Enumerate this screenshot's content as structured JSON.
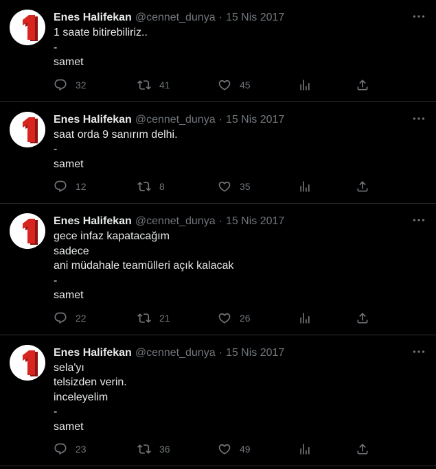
{
  "colors": {
    "background": "#000000",
    "text_primary": "#e7e9ea",
    "text_secondary": "#71767b",
    "divider": "#2f3336",
    "avatar_red": "#d7251f"
  },
  "tweets": [
    {
      "author_name": "Enes Halifekan",
      "handle": "@cennet_dunya",
      "separator": "·",
      "date": "15 Nis 2017",
      "lines": [
        "1 saate bitirebiliriz..",
        "-",
        "samet"
      ],
      "replies": "32",
      "retweets": "41",
      "likes": "45",
      "avatar_glyph": "1",
      "icons": [
        "more-icon",
        "reply-icon",
        "retweet-icon",
        "like-icon",
        "views-icon",
        "share-icon"
      ]
    },
    {
      "author_name": "Enes Halifekan",
      "handle": "@cennet_dunya",
      "separator": "·",
      "date": "15 Nis 2017",
      "lines": [
        "saat orda 9 sanırım delhi.",
        "-",
        "samet"
      ],
      "replies": "12",
      "retweets": "8",
      "likes": "35",
      "avatar_glyph": "1",
      "icons": [
        "more-icon",
        "reply-icon",
        "retweet-icon",
        "like-icon",
        "views-icon",
        "share-icon"
      ]
    },
    {
      "author_name": "Enes Halifekan",
      "handle": "@cennet_dunya",
      "separator": "·",
      "date": "15 Nis 2017",
      "lines": [
        "gece infaz kapatacağım",
        "sadece",
        "ani müdahale teamülleri açık kalacak",
        "-",
        "samet"
      ],
      "replies": "22",
      "retweets": "21",
      "likes": "26",
      "avatar_glyph": "1",
      "icons": [
        "more-icon",
        "reply-icon",
        "retweet-icon",
        "like-icon",
        "views-icon",
        "share-icon"
      ]
    },
    {
      "author_name": "Enes Halifekan",
      "handle": "@cennet_dunya",
      "separator": "·",
      "date": "15 Nis 2017",
      "lines": [
        "sela'yı",
        "telsizden verin.",
        "inceleyelim",
        "-",
        "samet"
      ],
      "replies": "23",
      "retweets": "36",
      "likes": "49",
      "avatar_glyph": "1",
      "icons": [
        "more-icon",
        "reply-icon",
        "retweet-icon",
        "like-icon",
        "views-icon",
        "share-icon"
      ]
    }
  ]
}
